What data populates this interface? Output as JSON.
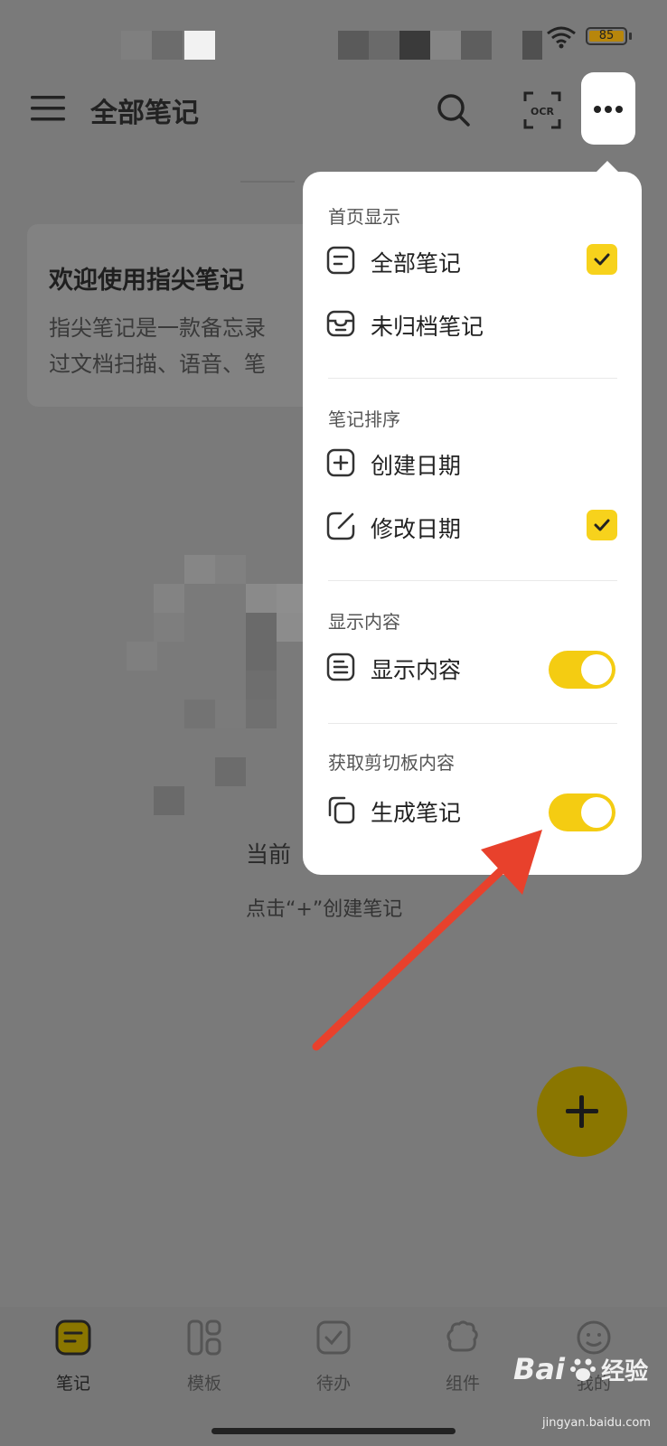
{
  "status_bar": {
    "battery": "85"
  },
  "app_bar": {
    "title": "全部笔记",
    "ocr_label": "OCR"
  },
  "welcome": {
    "title": "欢迎使用指尖笔记",
    "body_line1": "指尖笔记是一款备忘录",
    "body_line2": "过文档扫描、语音、笔"
  },
  "empty": {
    "title": "当前",
    "hint": "点击“+”创建笔记"
  },
  "menu": {
    "sections": [
      {
        "header": "首页显示",
        "items": [
          {
            "label": "全部笔记",
            "checked": true
          },
          {
            "label": "未归档笔记",
            "checked": false
          }
        ]
      },
      {
        "header": "笔记排序",
        "items": [
          {
            "label": "创建日期",
            "checked": false
          },
          {
            "label": "修改日期",
            "checked": true
          }
        ]
      },
      {
        "header": "显示内容",
        "items": [
          {
            "label": "显示内容",
            "toggle_on": true
          }
        ]
      },
      {
        "header": "获取剪切板内容",
        "items": [
          {
            "label": "生成笔记",
            "toggle_on": true
          }
        ]
      }
    ]
  },
  "bottom_nav": {
    "items": [
      {
        "label": "笔记",
        "icon": "note-icon",
        "active": true
      },
      {
        "label": "模板",
        "icon": "template-icon",
        "active": false
      },
      {
        "label": "待办",
        "icon": "todo-icon",
        "active": false
      },
      {
        "label": "组件",
        "icon": "widget-icon",
        "active": false
      },
      {
        "label": "我的",
        "icon": "profile-icon",
        "active": false
      }
    ]
  },
  "watermark": {
    "brand": "Bai",
    "brand2": "经验",
    "domain": "jingyan.baidu.com"
  },
  "colors": {
    "accent": "#f7d21c",
    "dim_overlay": "#7a7a7a",
    "arrow": "#e8412c"
  }
}
